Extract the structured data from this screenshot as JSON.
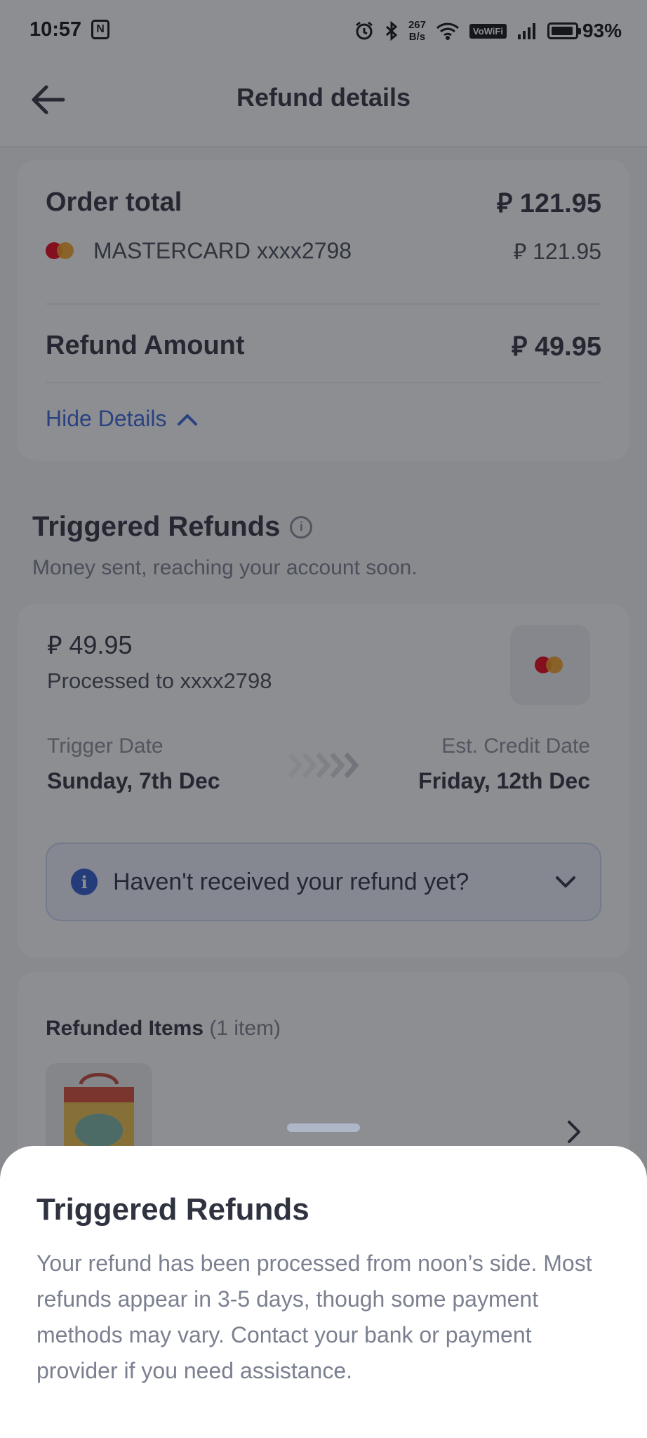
{
  "status_bar": {
    "time": "10:57",
    "notification_icon": "N",
    "speed_value": "267",
    "speed_unit": "B/s",
    "vowifi": "VoWiFi",
    "battery": "93%"
  },
  "header": {
    "title": "Refund details"
  },
  "summary": {
    "order_total_label": "Order total",
    "order_total_value": "⃁ 121.95",
    "card_label": "MASTERCARD xxxx2798",
    "card_value": "⃁ 121.95",
    "refund_amount_label": "Refund Amount",
    "refund_amount_value": "⃁ 49.95",
    "toggle_label": "Hide Details"
  },
  "triggered": {
    "title": "Triggered Refunds",
    "subtitle": "Money sent, reaching your account soon.",
    "amount": "⃁ 49.95",
    "processed_to": "Processed to xxxx2798",
    "trigger_label": "Trigger Date",
    "trigger_date": "Sunday, 7th Dec",
    "credit_label": "Est. Credit Date",
    "credit_date": "Friday, 12th Dec",
    "help_text": "Haven't received your refund yet?"
  },
  "items": {
    "title": "Refunded Items",
    "count": "(1 item)"
  },
  "sheet": {
    "title": "Triggered Refunds",
    "body": "Your refund has been processed from noon’s side. Most refunds appear in 3-5 days, though some payment methods may vary. Contact your bank or payment provider if you need assistance."
  },
  "colors": {
    "link": "#3866df",
    "info_badge": "#2f5bd3",
    "overlay": "rgba(28,30,36,0.5)"
  }
}
